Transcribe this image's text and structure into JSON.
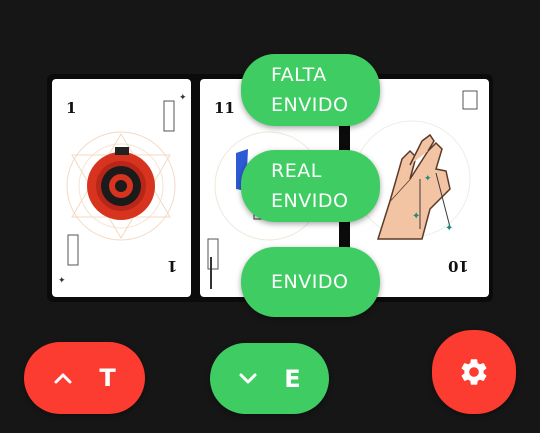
{
  "cards": [
    {
      "number": "1",
      "suit": "sun-emblem"
    },
    {
      "number": "11",
      "suit": "figure"
    },
    {
      "number": "10",
      "suit": "hand-figure"
    }
  ],
  "calls": {
    "falta_envido": [
      "FALTA",
      "ENVIDO"
    ],
    "real_envido": [
      "REAL",
      "ENVIDO"
    ],
    "envido": "ENVIDO"
  },
  "controls": {
    "truco_letter": "T",
    "envido_letter": "E",
    "truco_icon": "chevron-up-icon",
    "envido_icon": "chevron-down-icon",
    "settings_icon": "gear-icon"
  },
  "colors": {
    "green": "#3fcd63",
    "red": "#fc3c30",
    "background": "#161616"
  }
}
